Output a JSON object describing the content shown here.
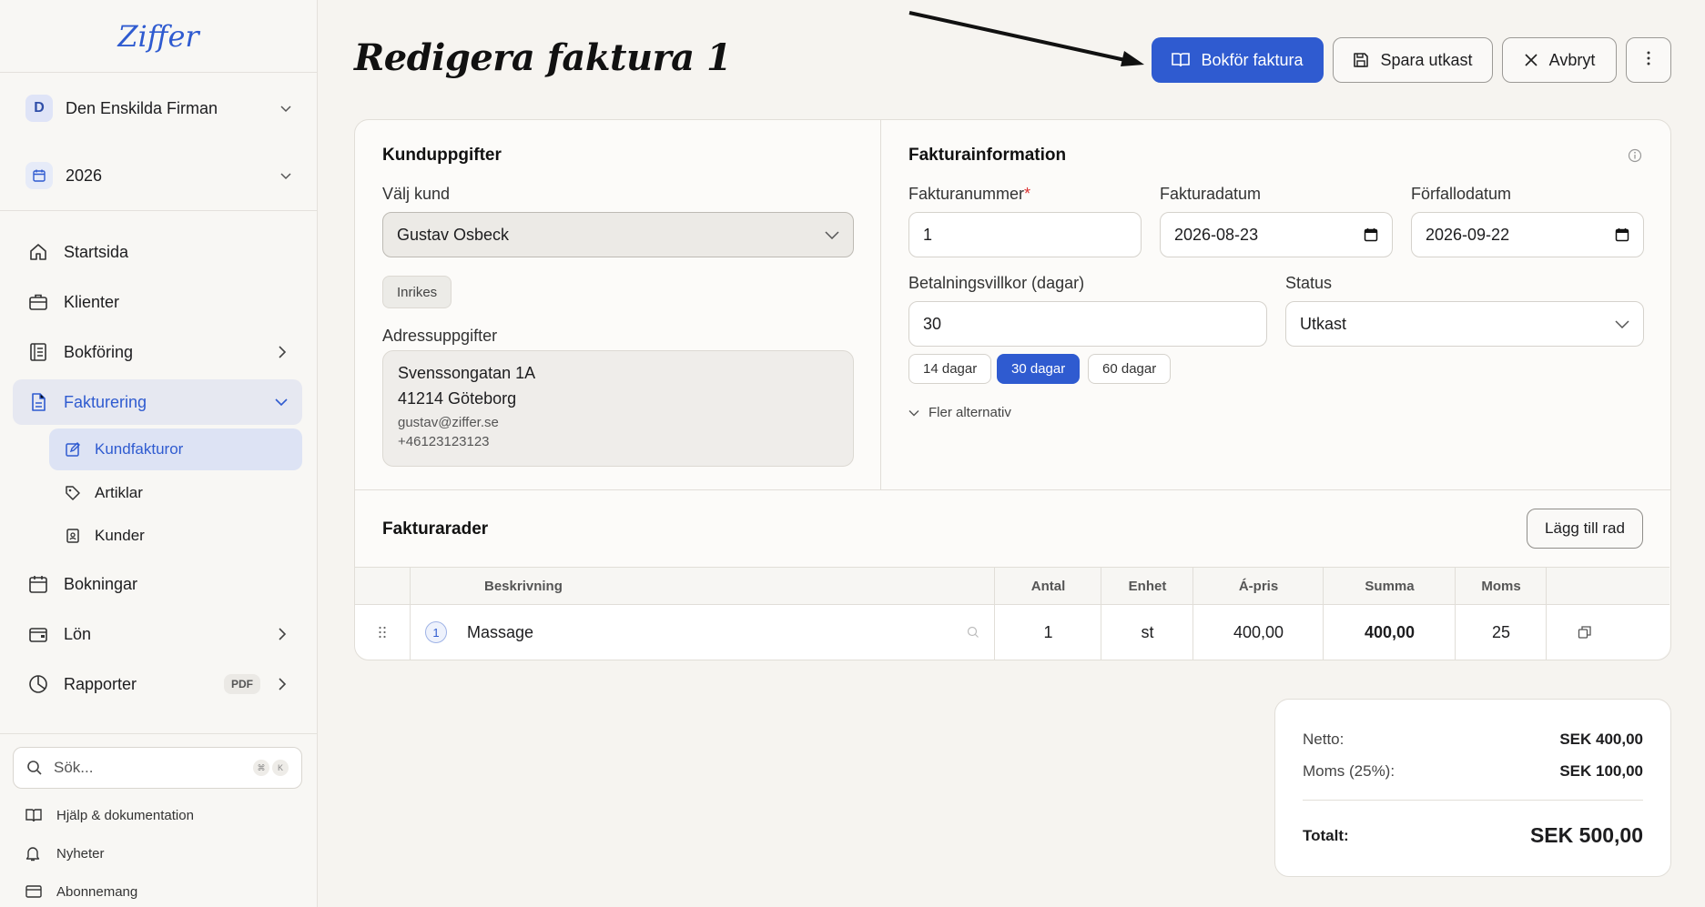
{
  "app": {
    "logo": "Ziffer"
  },
  "sidebar": {
    "company": {
      "initial": "D",
      "name": "Den Enskilda Firman"
    },
    "year": "2026",
    "nav": {
      "startsida": "Startsida",
      "klienter": "Klienter",
      "bokforing": "Bokföring",
      "fakturering": "Fakturering",
      "kundfakturor": "Kundfakturor",
      "artiklar": "Artiklar",
      "kunder": "Kunder",
      "bokningar": "Bokningar",
      "lon": "Lön",
      "rapporter": "Rapporter",
      "rapporter_badge": "PDF"
    },
    "search": {
      "placeholder": "Sök...",
      "kbd1": "⌘",
      "kbd2": "K"
    },
    "footer": {
      "help": "Hjälp & dokumentation",
      "news": "Nyheter",
      "subscription": "Abonnemang"
    }
  },
  "header": {
    "title": "Redigera faktura 1",
    "post_button": "Bokför faktura",
    "save_button": "Spara utkast",
    "cancel_button": "Avbryt"
  },
  "customer": {
    "section_title": "Kunduppgifter",
    "select_label": "Välj kund",
    "selected": "Gustav Osbeck",
    "type_chip": "Inrikes",
    "address_label": "Adressuppgifter",
    "street": "Svenssongatan 1A",
    "city": "41214 Göteborg",
    "email": "gustav@ziffer.se",
    "phone": "+46123123123"
  },
  "invoice_info": {
    "section_title": "Fakturainformation",
    "number_label": "Fakturanummer",
    "number_required": "*",
    "number": "1",
    "date_label": "Fakturadatum",
    "date": "2026-08-23",
    "due_label": "Förfallodatum",
    "due": "2026-09-22",
    "terms_label": "Betalningsvillkor (dagar)",
    "terms": "30",
    "status_label": "Status",
    "status": "Utkast",
    "term_options": [
      "14 dagar",
      "30 dagar",
      "60 dagar"
    ],
    "term_selected": "30 dagar",
    "more_options": "Fler alternativ"
  },
  "rows": {
    "section_title": "Fakturarader",
    "add_button": "Lägg till rad",
    "columns": {
      "description": "Beskrivning",
      "qty": "Antal",
      "unit": "Enhet",
      "price": "Á-pris",
      "sum": "Summa",
      "vat": "Moms"
    },
    "items": [
      {
        "num": "1",
        "description": "Massage",
        "qty": "1",
        "unit": "st",
        "price": "400,00",
        "sum": "400,00",
        "vat": "25"
      }
    ]
  },
  "totals": {
    "net_label": "Netto:",
    "net": "SEK 400,00",
    "vat_label": "Moms (25%):",
    "vat": "SEK 100,00",
    "total_label": "Totalt:",
    "total": "SEK 500,00"
  },
  "colors": {
    "accent": "#2f5bd0",
    "background": "#f6f4f0"
  }
}
